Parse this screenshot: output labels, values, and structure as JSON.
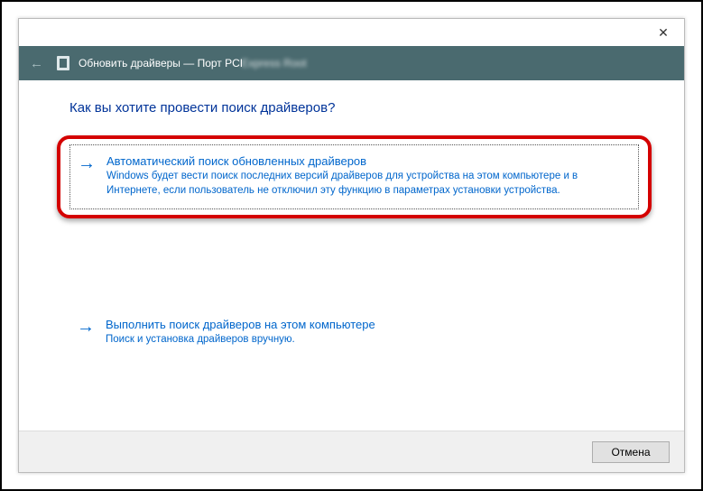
{
  "titlebar": {
    "close_glyph": "✕"
  },
  "header": {
    "back_glyph": "←",
    "title_prefix": "Обновить драйверы — Порт PCI",
    "title_blurred": "Express Root"
  },
  "heading": "Как вы хотите провести поиск драйверов?",
  "option_auto": {
    "arrow_glyph": "→",
    "title": "Автоматический поиск обновленных драйверов",
    "description": "Windows будет вести поиск последних версий драйверов для устройства на этом компьютере и в Интернете, если пользователь не отключил эту функцию в параметрах установки устройства."
  },
  "option_manual": {
    "arrow_glyph": "→",
    "title": "Выполнить поиск драйверов на этом компьютере",
    "description": "Поиск и установка драйверов вручную."
  },
  "footer": {
    "cancel_label": "Отмена"
  }
}
